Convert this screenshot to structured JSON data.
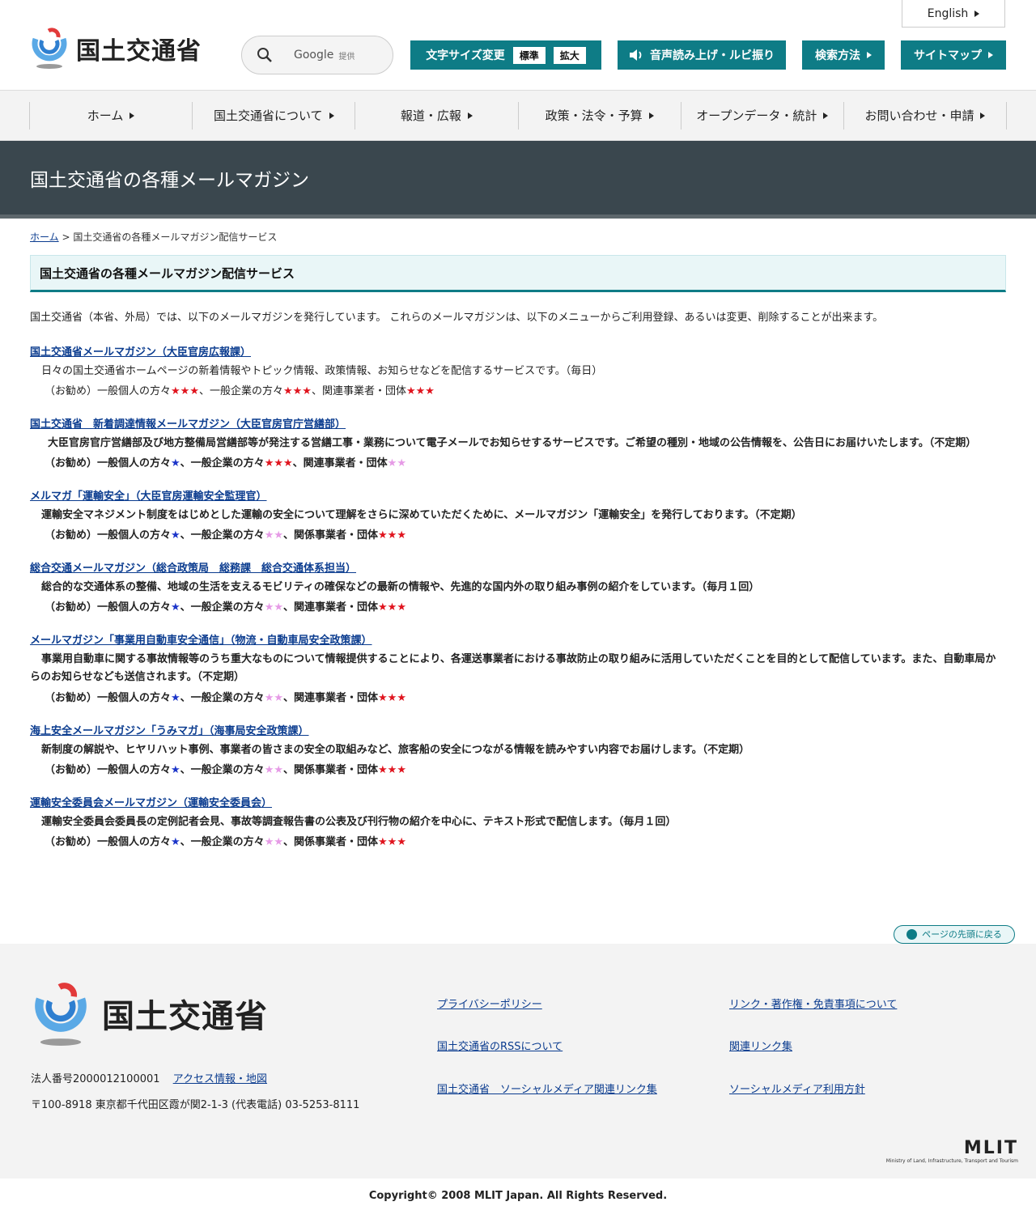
{
  "header": {
    "logo_text": "国土交通省",
    "search_label": "Google",
    "search_sub": "提供",
    "english_label": "English",
    "font_size_label": "文字サイズ変更",
    "font_standard": "標準",
    "font_large": "拡大",
    "voice_label": "音声読み上げ・ルビ振り",
    "search_method_label": "検索方法",
    "sitemap_label": "サイトマップ"
  },
  "nav": [
    {
      "label": "ホーム"
    },
    {
      "label": "国土交通省について"
    },
    {
      "label": "報道・広報"
    },
    {
      "label": "政策・法令・予算"
    },
    {
      "label": "オープンデータ・統計"
    },
    {
      "label": "お問い合わせ・申請"
    }
  ],
  "page_title": "国土交通省の各種メールマガジン",
  "breadcrumb": {
    "home": "ホーム",
    "sep": ">",
    "current": "国土交通省の各種メールマガジン配信サービス"
  },
  "section_title": "国土交通省の各種メールマガジン配信サービス",
  "intro": "国土交通省（本省、外局）では、以下のメールマガジンを発行しています。 これらのメールマガジンは、以下のメニューからご利用登録、あるいは変更、削除することが出来ます。",
  "stars": {
    "three": "★★★",
    "one": "★",
    "two": "★★"
  },
  "magazines": [
    {
      "title": "国土交通省メールマガジン（大臣官房広報課）",
      "desc": "日々の国土交通省ホームページの新着情報やトピック情報、政策情報、お知らせなどを配信するサービスです。（毎日）",
      "rec_a": "（お勧め）一般個人の方々",
      "rec_b": "、一般企業の方々",
      "rec_c": "、関連事業者・団体"
    },
    {
      "title": "国土交通省　新着調達情報メールマガジン（大臣官房官庁営繕部）",
      "desc": "大臣官房官庁営繕部及び地方整備局営繕部等が発注する営繕工事・業務について電子メールでお知らせするサービスです。ご希望の種別・地域の公告情報を、公告日にお届けいたします。（不定期）",
      "rec_a": "（お勧め）一般個人の方々",
      "rec_b": "、一般企業の方々",
      "rec_c": "、関連事業者・団体"
    },
    {
      "title": "メルマガ「運輸安全」（大臣官房運輸安全監理官）",
      "desc": "運輸安全マネジメント制度をはじめとした運輸の安全について理解をさらに深めていただくために、メールマガジン「運輸安全」を発行しております。（不定期）",
      "rec_a": "（お勧め）一般個人の方々",
      "rec_b": "、一般企業の方々",
      "rec_c": "、関係事業者・団体"
    },
    {
      "title": "総合交通メールマガジン（総合政策局　総務課　総合交通体系担当）",
      "desc": "総合的な交通体系の整備、地域の生活を支えるモビリティの確保などの最新の情報や、先進的な国内外の取り組み事例の紹介をしています。（毎月１回）",
      "rec_a": "（お勧め）一般個人の方々",
      "rec_b": "、一般企業の方々",
      "rec_c": "、関連事業者・団体"
    },
    {
      "title": "メールマガジン「事業用自動車安全通信」（物流・自動車局安全政策課）",
      "desc": "事業用自動車に関する事故情報等のうち重大なものについて情報提供することにより、各運送事業者における事故防止の取り組みに活用していただくことを目的として配信しています。また、自動車局からのお知らせなども送信されます。（不定期）",
      "rec_a": "（お勧め）一般個人の方々",
      "rec_b": "、一般企業の方々",
      "rec_c": "、関連事業者・団体"
    },
    {
      "title": "海上安全メールマガジン「うみマガ」（海事局安全政策課）",
      "desc": "新制度の解説や、ヒヤリハット事例、事業者の皆さまの安全の取組みなど、旅客船の安全につながる情報を読みやすい内容でお届けします。（不定期）",
      "rec_a": "（お勧め）一般個人の方々",
      "rec_b": "、一般企業の方々",
      "rec_c": "、関係事業者・団体"
    },
    {
      "title": "運輸安全委員会メールマガジン（運輸安全委員会）",
      "desc": "運輸安全委員会委員長の定例記者会見、事故等調査報告書の公表及び刊行物の紹介を中心に、テキスト形式で配信します。（毎月１回）",
      "rec_a": "（お勧め）一般個人の方々",
      "rec_b": "、一般企業の方々",
      "rec_c": "、関係事業者・団体"
    }
  ],
  "page_top": "ページの先頭に戻る",
  "footer": {
    "logo_text": "国土交通省",
    "corp_number": "法人番号2000012100001",
    "access_link": "アクセス情報・地図",
    "address": "〒100-8918 東京都千代田区霞が関2-1-3 (代表電話) 03-5253-8111",
    "links": [
      "プライバシーポリシー",
      "リンク・著作権・免責事項について",
      "国土交通省のRSSについて",
      "関連リンク集",
      "国土交通省　ソーシャルメディア関連リンク集",
      "ソーシャルメディア利用方針"
    ],
    "mlit": "MLIT",
    "mlit_sub": "Ministry of Land, Infrastructure, Transport and Tourism",
    "copyright": "Copyright© 2008 MLIT Japan. All Rights Reserved."
  },
  "colors": {
    "accent": "#0e7c86",
    "band": "#3a474e",
    "star_red": "#e0141e",
    "star_blue": "#1c35c9",
    "star_pink": "#e69be6"
  }
}
